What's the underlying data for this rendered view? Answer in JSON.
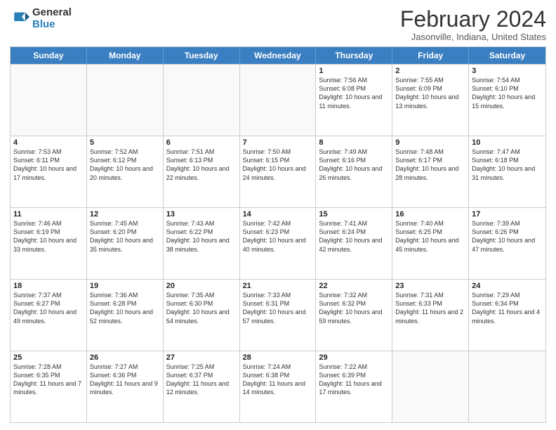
{
  "logo": {
    "general": "General",
    "blue": "Blue"
  },
  "title": "February 2024",
  "subtitle": "Jasonville, Indiana, United States",
  "days_of_week": [
    "Sunday",
    "Monday",
    "Tuesday",
    "Wednesday",
    "Thursday",
    "Friday",
    "Saturday"
  ],
  "weeks": [
    [
      {
        "day": "",
        "info": ""
      },
      {
        "day": "",
        "info": ""
      },
      {
        "day": "",
        "info": ""
      },
      {
        "day": "",
        "info": ""
      },
      {
        "day": "1",
        "info": "Sunrise: 7:56 AM\nSunset: 6:08 PM\nDaylight: 10 hours\nand 11 minutes."
      },
      {
        "day": "2",
        "info": "Sunrise: 7:55 AM\nSunset: 6:09 PM\nDaylight: 10 hours\nand 13 minutes."
      },
      {
        "day": "3",
        "info": "Sunrise: 7:54 AM\nSunset: 6:10 PM\nDaylight: 10 hours\nand 15 minutes."
      }
    ],
    [
      {
        "day": "4",
        "info": "Sunrise: 7:53 AM\nSunset: 6:11 PM\nDaylight: 10 hours\nand 17 minutes."
      },
      {
        "day": "5",
        "info": "Sunrise: 7:52 AM\nSunset: 6:12 PM\nDaylight: 10 hours\nand 20 minutes."
      },
      {
        "day": "6",
        "info": "Sunrise: 7:51 AM\nSunset: 6:13 PM\nDaylight: 10 hours\nand 22 minutes."
      },
      {
        "day": "7",
        "info": "Sunrise: 7:50 AM\nSunset: 6:15 PM\nDaylight: 10 hours\nand 24 minutes."
      },
      {
        "day": "8",
        "info": "Sunrise: 7:49 AM\nSunset: 6:16 PM\nDaylight: 10 hours\nand 26 minutes."
      },
      {
        "day": "9",
        "info": "Sunrise: 7:48 AM\nSunset: 6:17 PM\nDaylight: 10 hours\nand 28 minutes."
      },
      {
        "day": "10",
        "info": "Sunrise: 7:47 AM\nSunset: 6:18 PM\nDaylight: 10 hours\nand 31 minutes."
      }
    ],
    [
      {
        "day": "11",
        "info": "Sunrise: 7:46 AM\nSunset: 6:19 PM\nDaylight: 10 hours\nand 33 minutes."
      },
      {
        "day": "12",
        "info": "Sunrise: 7:45 AM\nSunset: 6:20 PM\nDaylight: 10 hours\nand 35 minutes."
      },
      {
        "day": "13",
        "info": "Sunrise: 7:43 AM\nSunset: 6:22 PM\nDaylight: 10 hours\nand 38 minutes."
      },
      {
        "day": "14",
        "info": "Sunrise: 7:42 AM\nSunset: 6:23 PM\nDaylight: 10 hours\nand 40 minutes."
      },
      {
        "day": "15",
        "info": "Sunrise: 7:41 AM\nSunset: 6:24 PM\nDaylight: 10 hours\nand 42 minutes."
      },
      {
        "day": "16",
        "info": "Sunrise: 7:40 AM\nSunset: 6:25 PM\nDaylight: 10 hours\nand 45 minutes."
      },
      {
        "day": "17",
        "info": "Sunrise: 7:39 AM\nSunset: 6:26 PM\nDaylight: 10 hours\nand 47 minutes."
      }
    ],
    [
      {
        "day": "18",
        "info": "Sunrise: 7:37 AM\nSunset: 6:27 PM\nDaylight: 10 hours\nand 49 minutes."
      },
      {
        "day": "19",
        "info": "Sunrise: 7:36 AM\nSunset: 6:28 PM\nDaylight: 10 hours\nand 52 minutes."
      },
      {
        "day": "20",
        "info": "Sunrise: 7:35 AM\nSunset: 6:30 PM\nDaylight: 10 hours\nand 54 minutes."
      },
      {
        "day": "21",
        "info": "Sunrise: 7:33 AM\nSunset: 6:31 PM\nDaylight: 10 hours\nand 57 minutes."
      },
      {
        "day": "22",
        "info": "Sunrise: 7:32 AM\nSunset: 6:32 PM\nDaylight: 10 hours\nand 59 minutes."
      },
      {
        "day": "23",
        "info": "Sunrise: 7:31 AM\nSunset: 6:33 PM\nDaylight: 11 hours\nand 2 minutes."
      },
      {
        "day": "24",
        "info": "Sunrise: 7:29 AM\nSunset: 6:34 PM\nDaylight: 11 hours\nand 4 minutes."
      }
    ],
    [
      {
        "day": "25",
        "info": "Sunrise: 7:28 AM\nSunset: 6:35 PM\nDaylight: 11 hours\nand 7 minutes."
      },
      {
        "day": "26",
        "info": "Sunrise: 7:27 AM\nSunset: 6:36 PM\nDaylight: 11 hours\nand 9 minutes."
      },
      {
        "day": "27",
        "info": "Sunrise: 7:25 AM\nSunset: 6:37 PM\nDaylight: 11 hours\nand 12 minutes."
      },
      {
        "day": "28",
        "info": "Sunrise: 7:24 AM\nSunset: 6:38 PM\nDaylight: 11 hours\nand 14 minutes."
      },
      {
        "day": "29",
        "info": "Sunrise: 7:22 AM\nSunset: 6:39 PM\nDaylight: 11 hours\nand 17 minutes."
      },
      {
        "day": "",
        "info": ""
      },
      {
        "day": "",
        "info": ""
      }
    ]
  ]
}
